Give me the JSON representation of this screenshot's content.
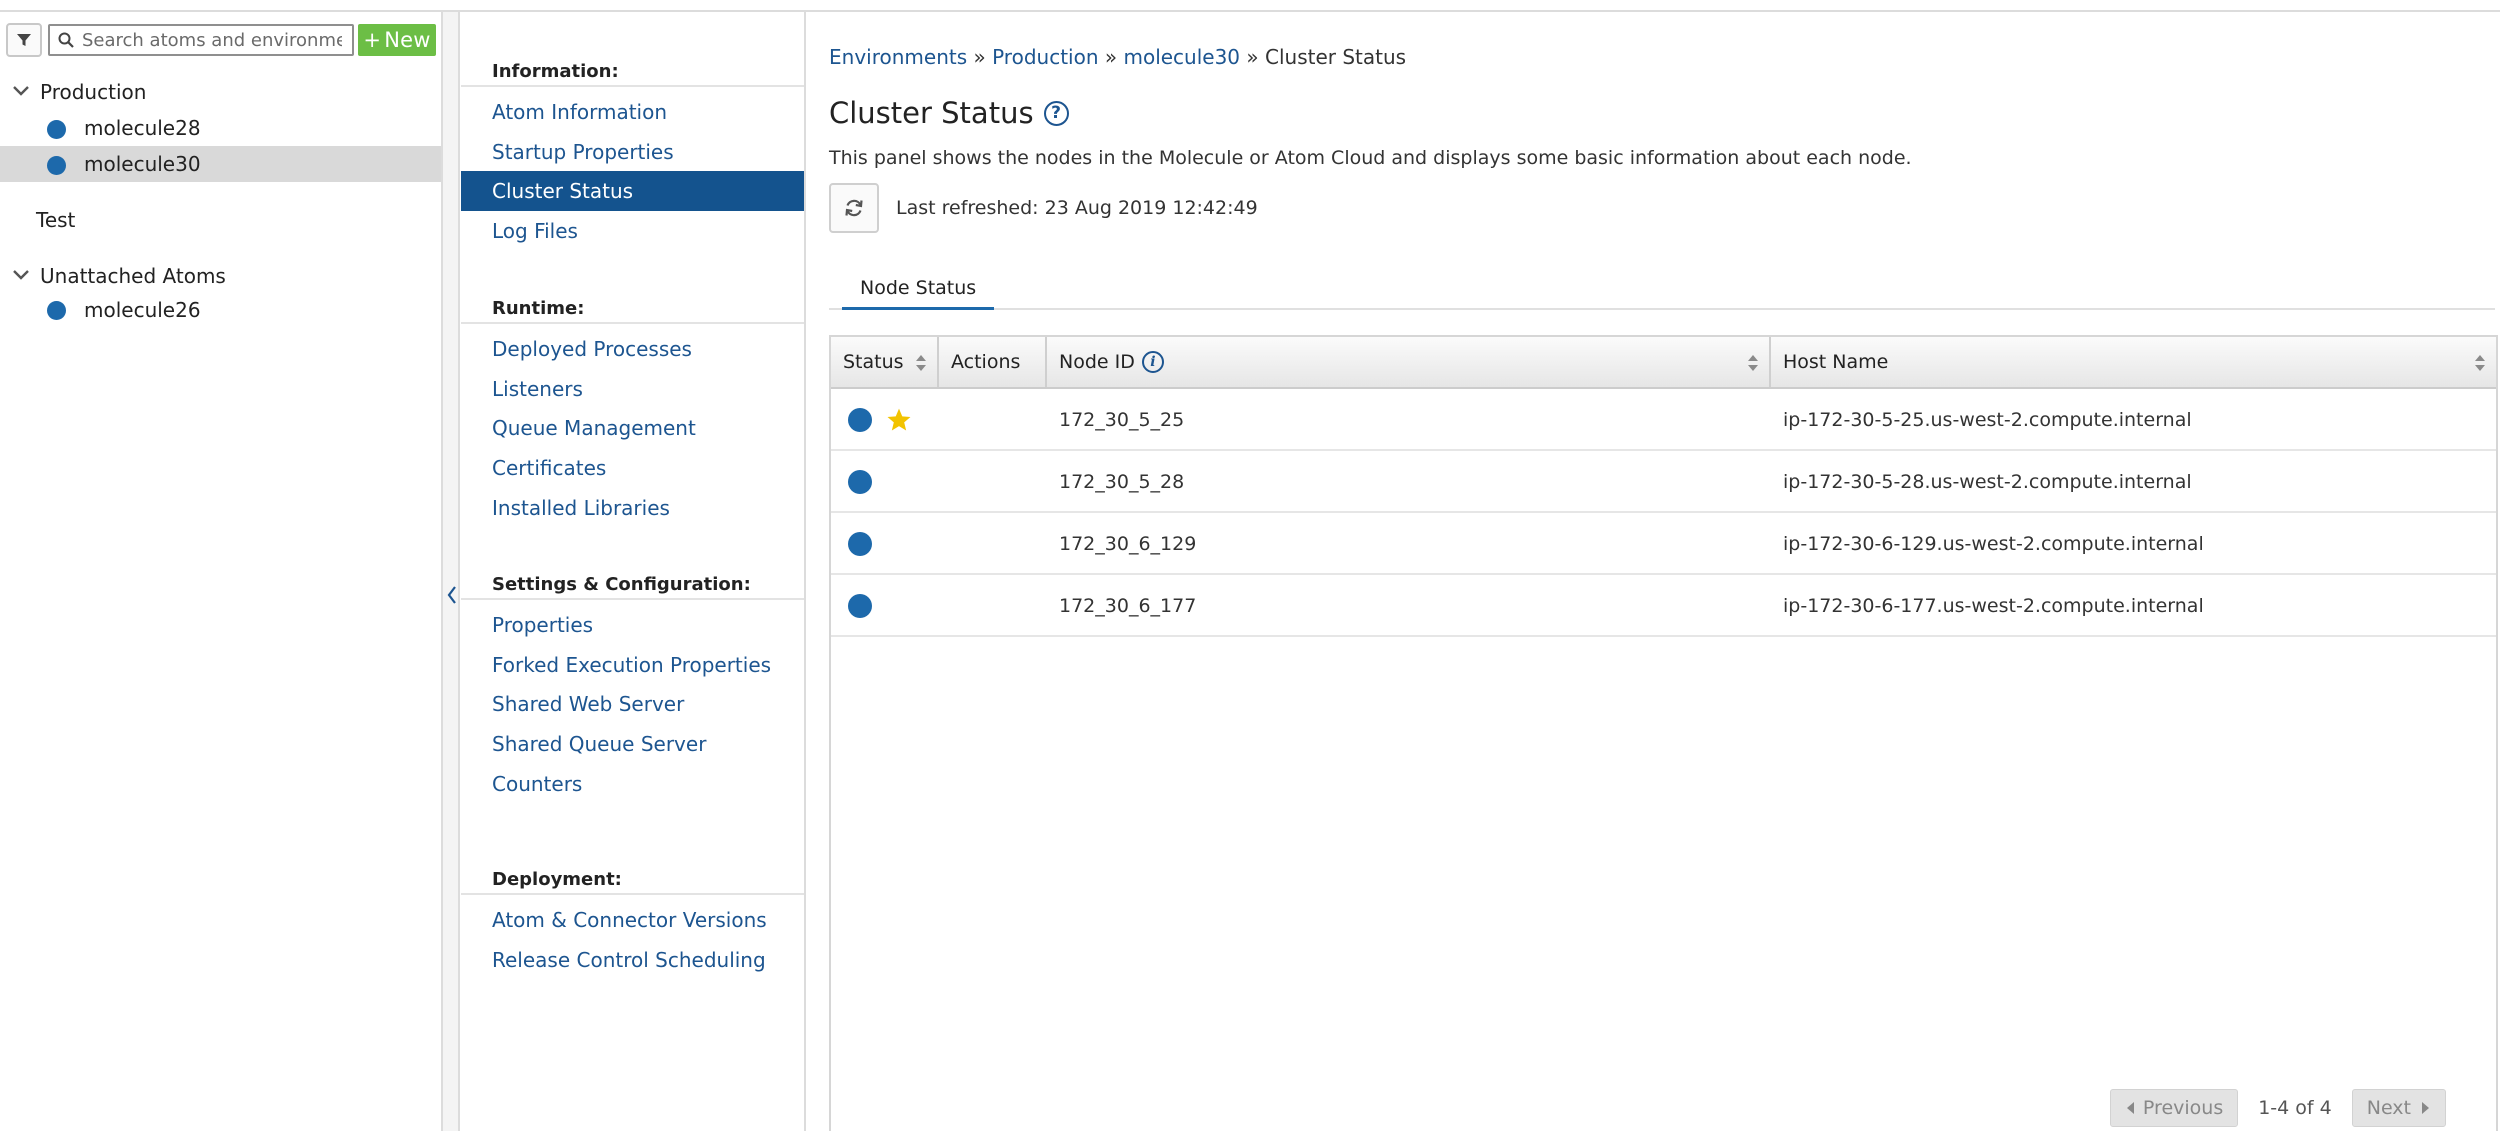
{
  "tree": {
    "search_placeholder": "Search atoms and environments",
    "new_label": "New",
    "groups": [
      {
        "label": "Production",
        "atoms": [
          "molecule28",
          "molecule30"
        ]
      },
      {
        "label": "Test",
        "atoms": []
      },
      {
        "label": "Unattached Atoms",
        "atoms": [
          "molecule26"
        ]
      }
    ],
    "selected_atom": "molecule30"
  },
  "nav": {
    "sections": [
      {
        "heading": "Information:",
        "items": [
          "Atom Information",
          "Startup Properties",
          "Cluster Status",
          "Log Files"
        ]
      },
      {
        "heading": "Runtime:",
        "items": [
          "Deployed Processes",
          "Listeners",
          "Queue Management",
          "Certificates",
          "Installed Libraries"
        ]
      },
      {
        "heading": "Settings & Configuration:",
        "items": [
          "Properties",
          "Forked Execution Properties",
          "Shared Web Server",
          "Shared Queue Server",
          "Counters"
        ]
      },
      {
        "heading": "Deployment:",
        "items": [
          "Atom & Connector Versions",
          "Release Control Scheduling"
        ]
      }
    ],
    "active_item": "Cluster Status"
  },
  "breadcrumb": {
    "items": [
      "Environments",
      "Production",
      "molecule30",
      "Cluster Status"
    ],
    "separator": "»"
  },
  "page": {
    "title": "Cluster Status",
    "help_glyph": "?",
    "description": "This panel shows the nodes in the Molecule or Atom Cloud and displays some basic information about each node.",
    "last_refreshed": "Last refreshed: 23 Aug 2019 12:42:49"
  },
  "tabs": [
    {
      "label": "Node Status",
      "active": true
    }
  ],
  "grid": {
    "columns": {
      "status": "Status",
      "actions": "Actions",
      "node_id": "Node ID",
      "host_name": "Host Name"
    },
    "info_glyph": "i",
    "rows": [
      {
        "node_id": "172_30_5_25",
        "host_name": "ip-172-30-5-25.us-west-2.compute.internal",
        "head": true
      },
      {
        "node_id": "172_30_5_28",
        "host_name": "ip-172-30-5-28.us-west-2.compute.internal",
        "head": false
      },
      {
        "node_id": "172_30_6_129",
        "host_name": "ip-172-30-6-129.us-west-2.compute.internal",
        "head": false
      },
      {
        "node_id": "172_30_6_177",
        "host_name": "ip-172-30-6-177.us-west-2.compute.internal",
        "head": false
      }
    ],
    "status_color": "#1d69ab",
    "head_star_color": "#f2c300"
  },
  "pager": {
    "previous": "Previous",
    "info": "1-4 of 4",
    "next": "Next"
  },
  "colors": {
    "accent": "#14538e",
    "link": "#1d5590",
    "new_button": "#6cbe45"
  }
}
